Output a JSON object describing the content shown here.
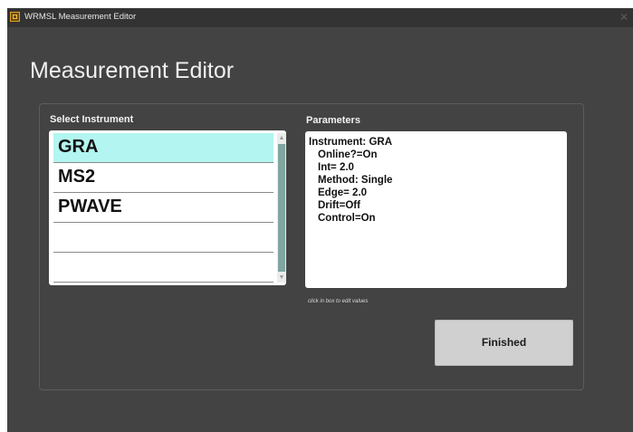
{
  "window": {
    "title": "WRMSL Measurement Editor",
    "close_glyph": "✕"
  },
  "page_title": "Measurement Editor",
  "instrument_panel": {
    "label": "Select Instrument",
    "items": [
      {
        "label": "GRA",
        "selected": true
      },
      {
        "label": "MS2",
        "selected": false
      },
      {
        "label": "PWAVE",
        "selected": false
      },
      {
        "label": "",
        "selected": false
      },
      {
        "label": "",
        "selected": false
      }
    ],
    "scroll_up_glyph": "▲",
    "scroll_down_glyph": "▼"
  },
  "parameters_panel": {
    "label": "Parameters",
    "lines": [
      "Instrument: GRA",
      "Online?=On",
      "Int= 2.0",
      "Method: Single",
      "Edge= 2.0",
      "Drift=Off",
      "Control=On"
    ],
    "hint": "click in box to edit values"
  },
  "finished_button": {
    "label": "Finished"
  },
  "colors": {
    "window_bg": "#434343",
    "titlebar_bg": "#333333",
    "selected_row": "#b3f5f0",
    "scroll_thumb": "#7fa69f",
    "button_bg": "#d0d0d0"
  }
}
